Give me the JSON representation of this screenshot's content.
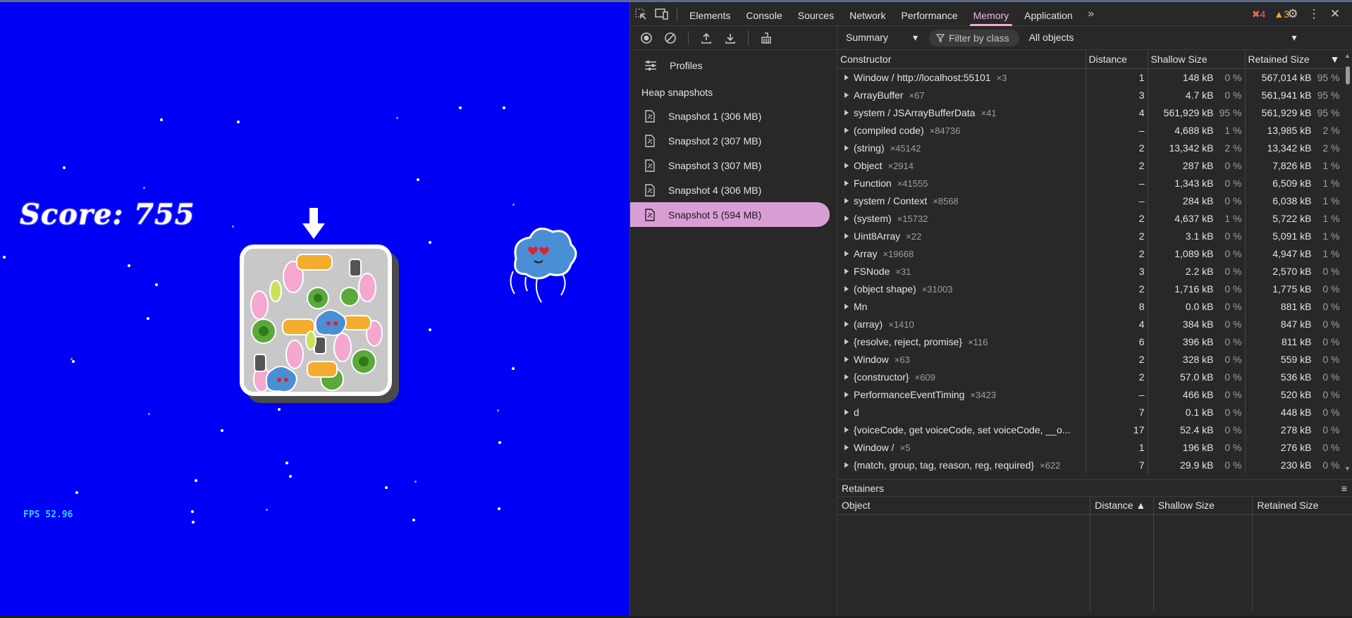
{
  "game": {
    "score_label": "Score: 755",
    "fps_label": "FPS 52.96",
    "background_color": "#0000f5"
  },
  "devtools": {
    "tabs": [
      "Elements",
      "Console",
      "Sources",
      "Network",
      "Performance",
      "Memory",
      "Application"
    ],
    "active_tab": "Memory",
    "errors_count": "4",
    "warnings_count": "3",
    "sidebar": {
      "profiles_label": "Profiles",
      "heap_snapshots_title": "Heap snapshots",
      "snapshots": [
        "Snapshot 1 (306 MB)",
        "Snapshot 2 (307 MB)",
        "Snapshot 3 (307 MB)",
        "Snapshot 4 (306 MB)",
        "Snapshot 5 (594 MB)"
      ],
      "selected_snapshot": "Snapshot 5 (594 MB)"
    },
    "toolbar": {
      "view_select": "Summary",
      "filter_placeholder": "Filter by class",
      "objects_select": "All objects"
    },
    "table": {
      "columns": [
        "Constructor",
        "Distance",
        "Shallow Size",
        "Retained Size"
      ],
      "rows": [
        {
          "name": "Window / http://localhost:55101",
          "count": "×3",
          "distance": "1",
          "shallow": "148 kB",
          "shallow_pct": "0 %",
          "retained": "567,014 kB",
          "retained_pct": "95 %"
        },
        {
          "name": "ArrayBuffer",
          "count": "×67",
          "distance": "3",
          "shallow": "4.7 kB",
          "shallow_pct": "0 %",
          "retained": "561,941 kB",
          "retained_pct": "95 %"
        },
        {
          "name": "system / JSArrayBufferData",
          "count": "×41",
          "distance": "4",
          "shallow": "561,929 kB",
          "shallow_pct": "95 %",
          "retained": "561,929 kB",
          "retained_pct": "95 %"
        },
        {
          "name": "(compiled code)",
          "count": "×84736",
          "distance": "–",
          "shallow": "4,688 kB",
          "shallow_pct": "1 %",
          "retained": "13,985 kB",
          "retained_pct": "2 %"
        },
        {
          "name": "(string)",
          "count": "×45142",
          "distance": "2",
          "shallow": "13,342 kB",
          "shallow_pct": "2 %",
          "retained": "13,342 kB",
          "retained_pct": "2 %"
        },
        {
          "name": "Object",
          "count": "×2914",
          "distance": "2",
          "shallow": "287 kB",
          "shallow_pct": "0 %",
          "retained": "7,826 kB",
          "retained_pct": "1 %"
        },
        {
          "name": "Function",
          "count": "×41555",
          "distance": "–",
          "shallow": "1,343 kB",
          "shallow_pct": "0 %",
          "retained": "6,509 kB",
          "retained_pct": "1 %"
        },
        {
          "name": "system / Context",
          "count": "×8568",
          "distance": "–",
          "shallow": "284 kB",
          "shallow_pct": "0 %",
          "retained": "6,038 kB",
          "retained_pct": "1 %"
        },
        {
          "name": "(system)",
          "count": "×15732",
          "distance": "2",
          "shallow": "4,637 kB",
          "shallow_pct": "1 %",
          "retained": "5,722 kB",
          "retained_pct": "1 %"
        },
        {
          "name": "Uint8Array",
          "count": "×22",
          "distance": "2",
          "shallow": "3.1 kB",
          "shallow_pct": "0 %",
          "retained": "5,091 kB",
          "retained_pct": "1 %"
        },
        {
          "name": "Array",
          "count": "×19668",
          "distance": "2",
          "shallow": "1,089 kB",
          "shallow_pct": "0 %",
          "retained": "4,947 kB",
          "retained_pct": "1 %"
        },
        {
          "name": "FSNode",
          "count": "×31",
          "distance": "3",
          "shallow": "2.2 kB",
          "shallow_pct": "0 %",
          "retained": "2,570 kB",
          "retained_pct": "0 %"
        },
        {
          "name": "(object shape)",
          "count": "×31003",
          "distance": "2",
          "shallow": "1,716 kB",
          "shallow_pct": "0 %",
          "retained": "1,775 kB",
          "retained_pct": "0 %"
        },
        {
          "name": "Mn",
          "count": "",
          "distance": "8",
          "shallow": "0.0 kB",
          "shallow_pct": "0 %",
          "retained": "881 kB",
          "retained_pct": "0 %"
        },
        {
          "name": "(array)",
          "count": "×1410",
          "distance": "4",
          "shallow": "384 kB",
          "shallow_pct": "0 %",
          "retained": "847 kB",
          "retained_pct": "0 %"
        },
        {
          "name": "{resolve, reject, promise}",
          "count": "×116",
          "distance": "6",
          "shallow": "396 kB",
          "shallow_pct": "0 %",
          "retained": "811 kB",
          "retained_pct": "0 %"
        },
        {
          "name": "Window",
          "count": "×63",
          "distance": "2",
          "shallow": "328 kB",
          "shallow_pct": "0 %",
          "retained": "559 kB",
          "retained_pct": "0 %"
        },
        {
          "name": "{constructor}",
          "count": "×609",
          "distance": "2",
          "shallow": "57.0 kB",
          "shallow_pct": "0 %",
          "retained": "536 kB",
          "retained_pct": "0 %"
        },
        {
          "name": "PerformanceEventTiming",
          "count": "×3423",
          "distance": "–",
          "shallow": "466 kB",
          "shallow_pct": "0 %",
          "retained": "520 kB",
          "retained_pct": "0 %"
        },
        {
          "name": "d",
          "count": "",
          "distance": "7",
          "shallow": "0.1 kB",
          "shallow_pct": "0 %",
          "retained": "448 kB",
          "retained_pct": "0 %"
        },
        {
          "name": "{voiceCode, get voiceCode, set voiceCode, __o...",
          "count": "",
          "distance": "17",
          "shallow": "52.4 kB",
          "shallow_pct": "0 %",
          "retained": "278 kB",
          "retained_pct": "0 %"
        },
        {
          "name": "Window /",
          "count": "×5",
          "distance": "1",
          "shallow": "196 kB",
          "shallow_pct": "0 %",
          "retained": "276 kB",
          "retained_pct": "0 %"
        },
        {
          "name": "{match, group, tag, reason, reg, required}",
          "count": "×622",
          "distance": "7",
          "shallow": "29.9 kB",
          "shallow_pct": "0 %",
          "retained": "230 kB",
          "retained_pct": "0 %"
        }
      ]
    },
    "retainers": {
      "title": "Retainers",
      "columns": [
        "Object",
        "Distance",
        "Shallow Size",
        "Retained Size"
      ]
    }
  }
}
